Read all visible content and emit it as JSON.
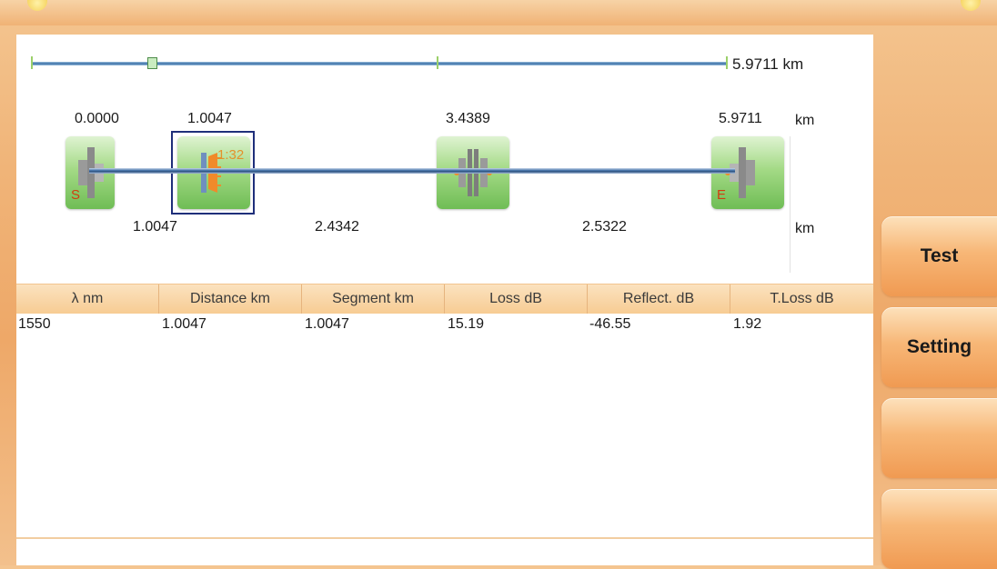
{
  "overview": {
    "total_label": "5.9711 km"
  },
  "positions": [
    "0.0000",
    "1.0047",
    "3.4389",
    "5.9711"
  ],
  "position_unit": "km",
  "segments": [
    "1.0047",
    "2.4342",
    "2.5322"
  ],
  "segment_unit": "km",
  "nodes": {
    "start_letter": "S",
    "end_letter": "E",
    "splitter_ratio": "1:32"
  },
  "table": {
    "headers": [
      "λ nm",
      "Distance km",
      "Segment km",
      "Loss dB",
      "Reflect. dB",
      "T.Loss dB"
    ],
    "rows": [
      [
        "1550",
        "1.0047",
        "1.0047",
        "15.19",
        "-46.55",
        "1.92"
      ]
    ]
  },
  "side_buttons": {
    "test": "Test",
    "setting": "Setting",
    "blank1": "",
    "blank2": ""
  },
  "colors": {
    "accent": "#f09a52",
    "node_green": "#6fbd55",
    "fiber_blue": "#3f6fa6",
    "selection": "#1f2f7a"
  }
}
